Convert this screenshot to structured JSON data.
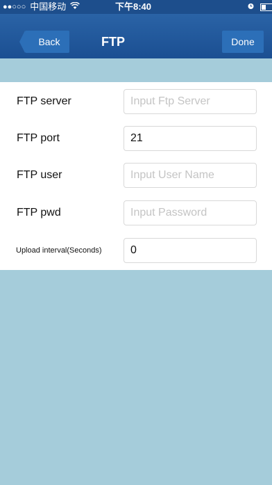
{
  "status_bar": {
    "signal_dots": "●●○○○",
    "carrier": "中国移动",
    "wifi_icon": "wifi-icon",
    "time": "下午8:40",
    "alarm_icon": "alarm-icon",
    "battery_icon": "battery-icon"
  },
  "nav": {
    "back_label": "Back",
    "title": "FTP",
    "done_label": "Done"
  },
  "form": {
    "server": {
      "label": "FTP server",
      "value": "",
      "placeholder": "Input Ftp Server"
    },
    "port": {
      "label": "FTP port",
      "value": "21",
      "placeholder": ""
    },
    "user": {
      "label": "FTP user",
      "value": "",
      "placeholder": "Input User Name"
    },
    "pwd": {
      "label": "FTP pwd",
      "value": "",
      "placeholder": "Input Password"
    },
    "interval": {
      "label": "Upload interval(Seconds)",
      "value": "0",
      "placeholder": ""
    }
  },
  "colors": {
    "nav_bar": "#1b4f92",
    "button": "#2c6fb8",
    "background": "#a5ccda"
  }
}
